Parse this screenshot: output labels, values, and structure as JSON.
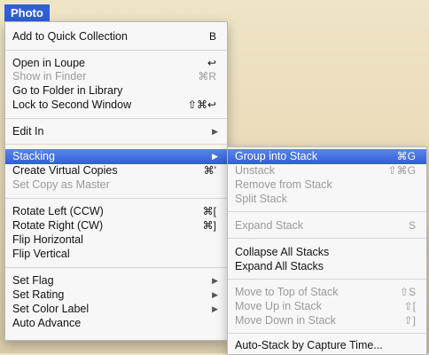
{
  "menubar": {
    "title": "Photo"
  },
  "main_menu": {
    "items": [
      {
        "label": "Add to Quick Collection",
        "shortcut": "B",
        "disabled": false
      },
      {
        "label": "Open in Loupe",
        "shortcut": "↩",
        "disabled": false
      },
      {
        "label": "Show in Finder",
        "shortcut": "⌘R",
        "disabled": true
      },
      {
        "label": "Go to Folder in Library",
        "shortcut": "",
        "disabled": false
      },
      {
        "label": "Lock to Second Window",
        "shortcut": "⇧⌘↩",
        "disabled": false
      },
      {
        "label": "Edit In",
        "shortcut": "▶",
        "disabled": false
      },
      {
        "label": "Stacking",
        "shortcut": "▶",
        "disabled": false
      },
      {
        "label": "Create Virtual Copies",
        "shortcut": "⌘'",
        "disabled": false
      },
      {
        "label": "Set Copy as Master",
        "shortcut": "",
        "disabled": true
      },
      {
        "label": "Rotate Left (CCW)",
        "shortcut": "⌘[",
        "disabled": false
      },
      {
        "label": "Rotate Right (CW)",
        "shortcut": "⌘]",
        "disabled": false
      },
      {
        "label": "Flip Horizontal",
        "shortcut": "",
        "disabled": false
      },
      {
        "label": "Flip Vertical",
        "shortcut": "",
        "disabled": false
      },
      {
        "label": "Set Flag",
        "shortcut": "▶",
        "disabled": false
      },
      {
        "label": "Set Rating",
        "shortcut": "▶",
        "disabled": false
      },
      {
        "label": "Set Color Label",
        "shortcut": "▶",
        "disabled": false
      },
      {
        "label": "Auto Advance",
        "shortcut": "",
        "disabled": false
      }
    ]
  },
  "stacking_submenu": {
    "items": [
      {
        "label": "Group into Stack",
        "shortcut": "⌘G",
        "disabled": false
      },
      {
        "label": "Unstack",
        "shortcut": "⇧⌘G",
        "disabled": true
      },
      {
        "label": "Remove from Stack",
        "shortcut": "",
        "disabled": true
      },
      {
        "label": "Split Stack",
        "shortcut": "",
        "disabled": true
      },
      {
        "label": "Expand Stack",
        "shortcut": "S",
        "disabled": true
      },
      {
        "label": "Collapse All Stacks",
        "shortcut": "",
        "disabled": false
      },
      {
        "label": "Expand All Stacks",
        "shortcut": "",
        "disabled": false
      },
      {
        "label": "Move to Top of Stack",
        "shortcut": "⇧S",
        "disabled": true
      },
      {
        "label": "Move Up in Stack",
        "shortcut": "⇧[",
        "disabled": true
      },
      {
        "label": "Move Down in Stack",
        "shortcut": "⇧]",
        "disabled": true
      },
      {
        "label": "Auto-Stack by Capture Time...",
        "shortcut": "",
        "disabled": false
      }
    ]
  }
}
